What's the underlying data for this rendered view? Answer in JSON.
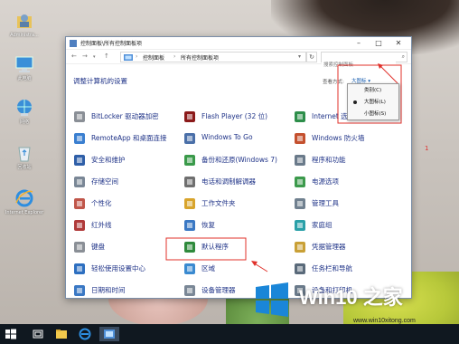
{
  "desktop": {
    "icons": [
      {
        "label": "Administra...",
        "icon": "user-folder-icon"
      },
      {
        "label": "此电脑",
        "icon": "this-pc-icon"
      },
      {
        "label": "网络",
        "icon": "network-icon"
      },
      {
        "label": "回收站",
        "icon": "recycle-bin-icon"
      },
      {
        "label": "Internet Explorer",
        "icon": "internet-explorer-icon"
      }
    ]
  },
  "window": {
    "title": "控制面板\\所有控制面板项",
    "breadcrumb": [
      "控制面板",
      "所有控制面板项"
    ],
    "search_placeholder": "搜索控制面板",
    "heading": "调整计算机的设置",
    "view_by_label": "查看方式:",
    "view_by_value": "大图标 ▾",
    "items": [
      {
        "label": "BitLocker 驱动器加密",
        "icon": "bitlocker-icon"
      },
      {
        "label": "Flash Player (32 位)",
        "icon": "flash-player-icon"
      },
      {
        "label": "Internet 选项",
        "icon": "internet-options-icon"
      },
      {
        "label": "RemoteApp 和桌面连接",
        "icon": "remoteapp-icon"
      },
      {
        "label": "Windows To Go",
        "icon": "windows-to-go-icon"
      },
      {
        "label": "Windows 防火墙",
        "icon": "firewall-icon"
      },
      {
        "label": "安全和维护",
        "icon": "security-maintenance-icon"
      },
      {
        "label": "备份和还原(Windows 7)",
        "icon": "backup-restore-icon"
      },
      {
        "label": "程序和功能",
        "icon": "programs-features-icon"
      },
      {
        "label": "存储空间",
        "icon": "storage-spaces-icon"
      },
      {
        "label": "电话和调制解调器",
        "icon": "phone-modem-icon"
      },
      {
        "label": "电源选项",
        "icon": "power-options-icon"
      },
      {
        "label": "个性化",
        "icon": "personalization-icon"
      },
      {
        "label": "工作文件夹",
        "icon": "work-folders-icon"
      },
      {
        "label": "管理工具",
        "icon": "admin-tools-icon"
      },
      {
        "label": "红外线",
        "icon": "infrared-icon"
      },
      {
        "label": "恢复",
        "icon": "recovery-icon"
      },
      {
        "label": "家庭组",
        "icon": "homegroup-icon"
      },
      {
        "label": "键盘",
        "icon": "keyboard-icon"
      },
      {
        "label": "默认程序",
        "icon": "default-programs-icon"
      },
      {
        "label": "凭据管理器",
        "icon": "credential-manager-icon"
      },
      {
        "label": "轻松使用设置中心",
        "icon": "ease-of-access-icon"
      },
      {
        "label": "区域",
        "icon": "region-icon"
      },
      {
        "label": "任务栏和导航",
        "icon": "taskbar-navigation-icon"
      },
      {
        "label": "日期和时间",
        "icon": "date-time-icon"
      },
      {
        "label": "设备管理器",
        "icon": "device-manager-icon"
      },
      {
        "label": "设备和打印机",
        "icon": "devices-printers-icon"
      }
    ]
  },
  "dropdown": {
    "options": [
      {
        "label": "类别(C)",
        "selected": false
      },
      {
        "label": "大图标(L)",
        "selected": true
      },
      {
        "label": "小图标(S)",
        "selected": false
      }
    ]
  },
  "annotation_number": "1",
  "watermark": {
    "title": "Win10 之家",
    "url": "www.win10xitong.com"
  },
  "colors": {
    "link_blue": "#1e3287",
    "annotation_red": "#e0302a",
    "win_blue": "#1a86d8"
  }
}
